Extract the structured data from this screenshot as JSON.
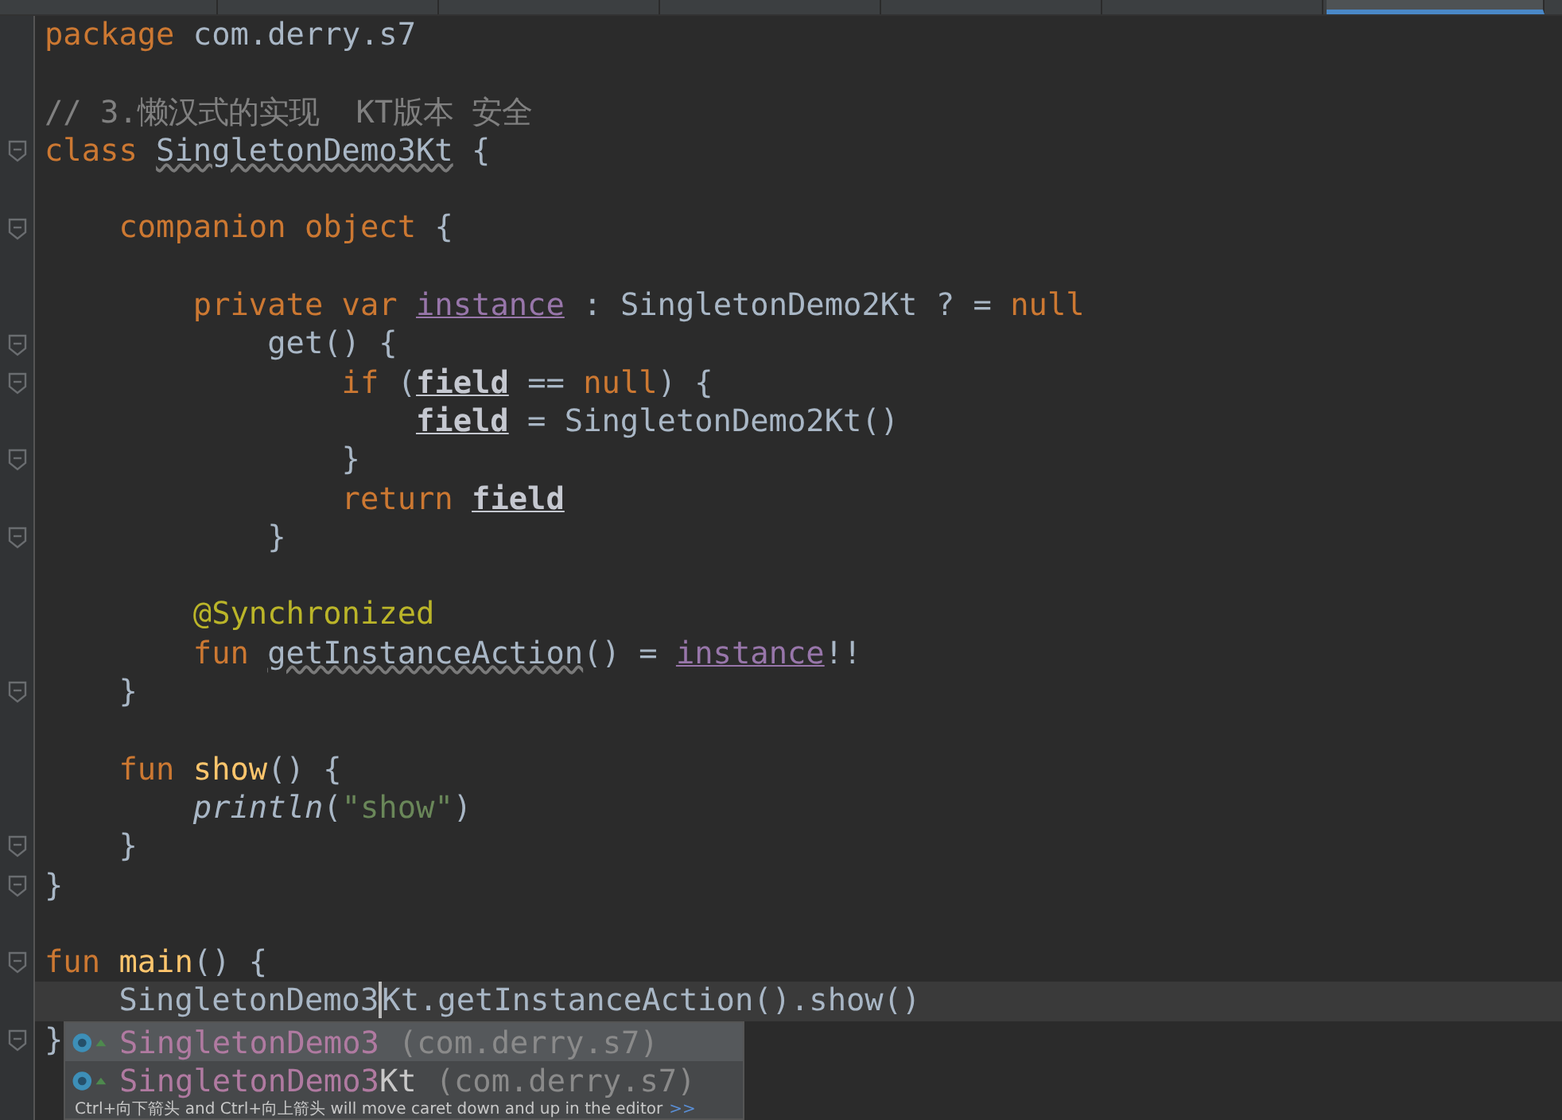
{
  "tabs": [
    {
      "selected": false
    },
    {
      "selected": false
    },
    {
      "selected": false
    },
    {
      "selected": false
    },
    {
      "selected": false
    },
    {
      "selected": false
    },
    {
      "selected": true
    }
  ],
  "editor": {
    "lines": [
      {
        "fold": false,
        "current": false,
        "tokens": [
          {
            "kind": "keyword",
            "text": "package"
          },
          {
            "kind": "plain",
            "text": " com.derry.s7"
          }
        ]
      },
      {
        "fold": false,
        "current": false
      },
      {
        "fold": false,
        "current": false,
        "tokens": [
          {
            "kind": "comment",
            "text": "// 3.懒汉式的实现  KT版本 安全"
          }
        ]
      },
      {
        "fold": true,
        "current": false,
        "tokens": [
          {
            "kind": "keyword",
            "text": "class "
          },
          {
            "kind": "warn",
            "text": "SingletonDemo3Kt"
          },
          {
            "kind": "plain",
            "text": " {"
          }
        ]
      },
      {
        "fold": false,
        "current": false
      },
      {
        "fold": true,
        "current": false,
        "tokens": [
          {
            "kind": "keyword",
            "text": "    companion object"
          },
          {
            "kind": "plain",
            "text": " {"
          }
        ]
      },
      {
        "fold": false,
        "current": false
      },
      {
        "fold": false,
        "current": false,
        "tokens": [
          {
            "kind": "keyword",
            "text": "        private var "
          },
          {
            "kind": "property",
            "text": "instance"
          },
          {
            "kind": "plain",
            "text": " : SingletonDemo2Kt ? = "
          },
          {
            "kind": "keyword",
            "text": "null"
          }
        ]
      },
      {
        "fold": true,
        "current": false,
        "tokens": [
          {
            "kind": "plain",
            "text": "            get() {"
          }
        ]
      },
      {
        "fold": true,
        "current": false,
        "tokens": [
          {
            "kind": "keyword",
            "text": "                if "
          },
          {
            "kind": "plain",
            "text": "("
          },
          {
            "kind": "field",
            "text": "field"
          },
          {
            "kind": "plain",
            "text": " == "
          },
          {
            "kind": "keyword",
            "text": "null"
          },
          {
            "kind": "plain",
            "text": ") {"
          }
        ]
      },
      {
        "fold": false,
        "current": false,
        "tokens": [
          {
            "kind": "field",
            "text": "                    field"
          },
          {
            "kind": "plain",
            "text": " = SingletonDemo2Kt()"
          }
        ]
      },
      {
        "fold": true,
        "current": false,
        "tokens": [
          {
            "kind": "plain",
            "text": "                }"
          }
        ]
      },
      {
        "fold": false,
        "current": false,
        "tokens": [
          {
            "kind": "keyword",
            "text": "                return "
          },
          {
            "kind": "field",
            "text": "field"
          }
        ]
      },
      {
        "fold": true,
        "current": false,
        "tokens": [
          {
            "kind": "plain",
            "text": "            }"
          }
        ]
      },
      {
        "fold": false,
        "current": false
      },
      {
        "fold": false,
        "current": false,
        "tokens": [
          {
            "kind": "annotation",
            "text": "        @Synchronized"
          }
        ]
      },
      {
        "fold": false,
        "current": false,
        "tokens": [
          {
            "kind": "keyword",
            "text": "        fun "
          },
          {
            "kind": "warn",
            "text": "getInstanceAction"
          },
          {
            "kind": "plain",
            "text": "() = "
          },
          {
            "kind": "property",
            "text": "instance"
          },
          {
            "kind": "plain",
            "text": "!!"
          }
        ]
      },
      {
        "fold": true,
        "current": false,
        "tokens": [
          {
            "kind": "plain",
            "text": "    }"
          }
        ]
      },
      {
        "fold": false,
        "current": false
      },
      {
        "fold": false,
        "current": false,
        "tokens": [
          {
            "kind": "keyword",
            "text": "    fun "
          },
          {
            "kind": "function",
            "text": "show"
          },
          {
            "kind": "plain",
            "text": "() {"
          }
        ]
      },
      {
        "fold": false,
        "current": false,
        "tokens": [
          {
            "kind": "italic",
            "text": "        println"
          },
          {
            "kind": "plain",
            "text": "("
          },
          {
            "kind": "string",
            "text": "\"show\""
          },
          {
            "kind": "plain",
            "text": ")"
          }
        ]
      },
      {
        "fold": true,
        "current": false,
        "tokens": [
          {
            "kind": "plain",
            "text": "    }"
          }
        ]
      },
      {
        "fold": true,
        "current": false,
        "tokens": [
          {
            "kind": "plain",
            "text": "}"
          }
        ]
      },
      {
        "fold": false,
        "current": false
      },
      {
        "fold": true,
        "current": false,
        "tokens": [
          {
            "kind": "keyword",
            "text": "fun "
          },
          {
            "kind": "function",
            "text": "main"
          },
          {
            "kind": "plain",
            "text": "() {"
          }
        ]
      },
      {
        "fold": false,
        "current": true,
        "tokens": [
          {
            "kind": "plain",
            "text": "    SingletonDemo3"
          },
          {
            "kind": "caret",
            "text": "Kt.getInstanceAction().show()"
          }
        ]
      },
      {
        "fold": true,
        "current": false,
        "tokens": [
          {
            "kind": "plain",
            "text": "}"
          }
        ]
      }
    ]
  },
  "completion": {
    "items": [
      {
        "selected": true,
        "name_match": "SingletonDemo3",
        "package": "(com.derry.s7)"
      },
      {
        "selected": false,
        "name_match": "SingletonDemo3",
        "name_rest": "Kt",
        "package": "(com.derry.s7)"
      }
    ],
    "hint": "Ctrl+向下箭头 and Ctrl+向上箭头 will move caret down and up in the editor",
    "hint_link": ">>"
  }
}
